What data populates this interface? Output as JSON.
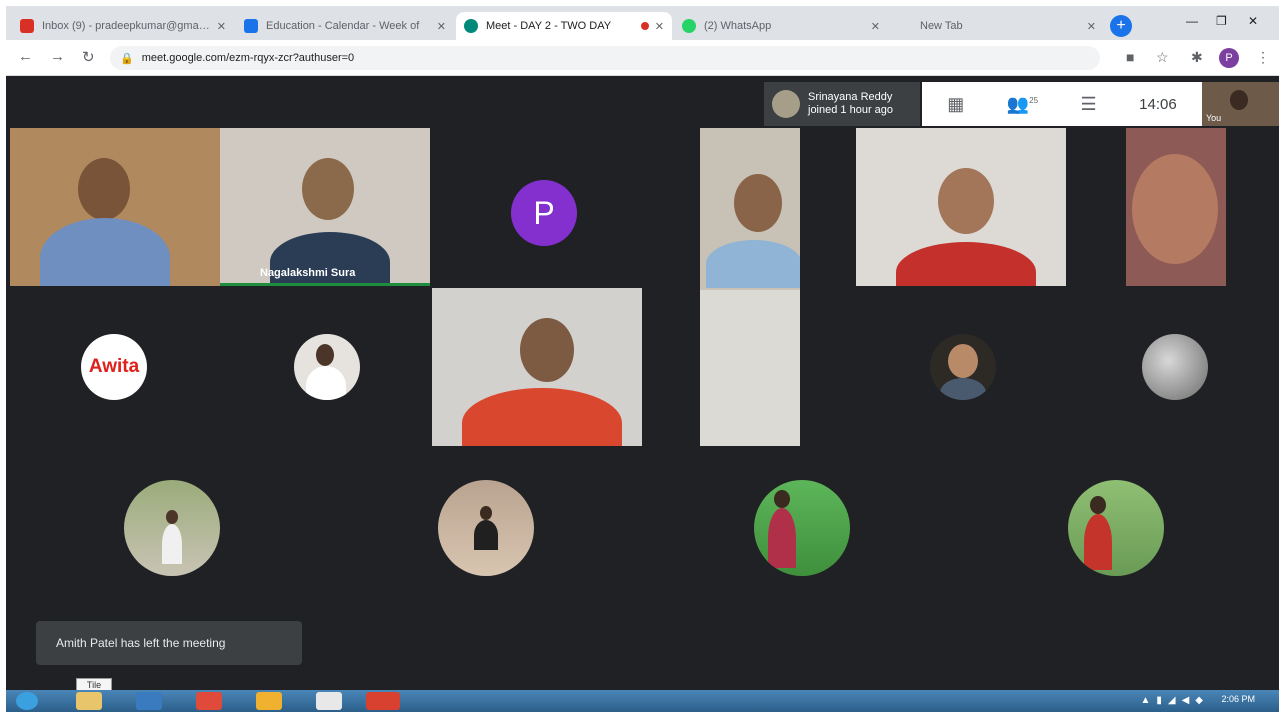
{
  "browser": {
    "tabs": [
      {
        "title": "Inbox (9) - pradeepkumar@gmail.com",
        "icon": "gmail-icon",
        "active": false
      },
      {
        "title": "Education - Calendar - Week of",
        "icon": "calendar-icon",
        "active": false
      },
      {
        "title": "Meet - DAY 2 - TWO DAY",
        "icon": "meet-icon",
        "active": true
      },
      {
        "title": "(2) WhatsApp",
        "icon": "whatsapp-icon",
        "active": false
      },
      {
        "title": "New Tab",
        "icon": "newtab-icon",
        "active": false
      }
    ],
    "address": "meet.google.com/ezm-rqyx-zcr?authuser=0",
    "profile_initial": "P"
  },
  "meet": {
    "presenter_notice": {
      "name": "Srinayana Reddy",
      "text": "joined 1 hour ago"
    },
    "clock": "14:06",
    "self_label": "You",
    "participant_count": "25",
    "tiles": [
      {
        "name": ""
      },
      {
        "name": "Nagalakshmi Sura"
      },
      {
        "name": "",
        "letter": "P"
      },
      {
        "name": ""
      },
      {
        "name": ""
      },
      {
        "name": ""
      },
      {
        "name": ""
      },
      {
        "name": ""
      }
    ],
    "logo_text": "Awita",
    "toast": "Amith Patel has left the meeting"
  },
  "taskbar": {
    "clock": "2:06 PM",
    "tooltip": "Tile"
  },
  "colors": {
    "meet_bg": "#202124",
    "tile_bg": "#3c4043",
    "accent_purple": "#8430ce",
    "active_speaker": "#1e8e3e",
    "logo_red": "#e0201b"
  }
}
